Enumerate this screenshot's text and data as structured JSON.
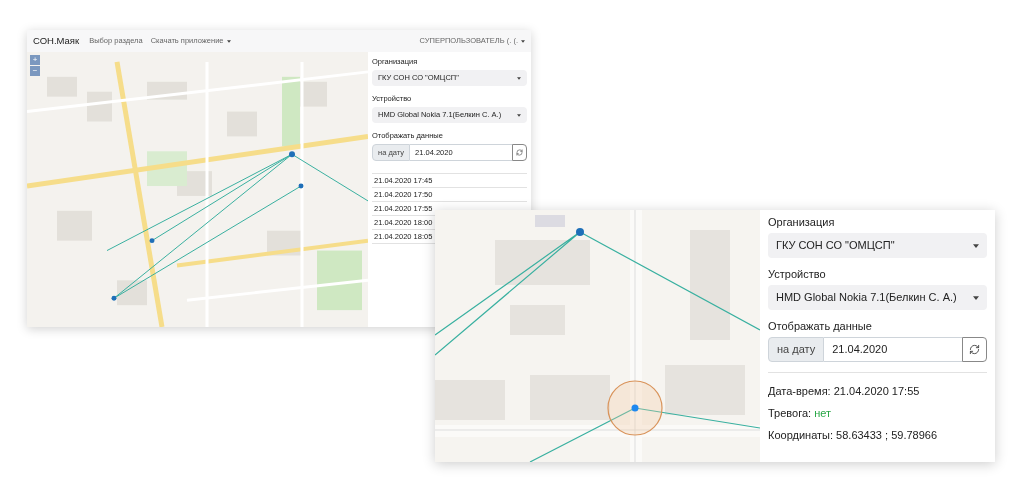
{
  "back_window": {
    "brand": "СОН.Маяк",
    "nav": [
      {
        "label": "Выбор раздела",
        "dropdown": false
      },
      {
        "label": "Скачать приложение",
        "dropdown": true
      }
    ],
    "user": {
      "label": "СУПЕРПОЛЬЗОВАТЕЛЬ (. (.",
      "dropdown": true
    },
    "map": {
      "zoom_in": "+",
      "zoom_out": "−"
    },
    "panel": {
      "organization": {
        "label": "Организация",
        "value": "ГКУ СОН СО \"ОМЦСП\""
      },
      "device": {
        "label": "Устройство",
        "value": "HMD Global Nokia 7.1(Белкин С. А.)"
      },
      "display": {
        "label": "Отображать данные",
        "addon": "на дату",
        "value": "21.04.2020"
      },
      "records": [
        "21.04.2020 17:45",
        "21.04.2020 17:50",
        "21.04.2020 17:55",
        "21.04.2020 18:00",
        "21.04.2020 18:05"
      ]
    }
  },
  "front_window": {
    "panel": {
      "organization": {
        "label": "Организация",
        "value": "ГКУ СОН СО \"ОМЦСП\""
      },
      "device": {
        "label": "Устройство",
        "value": "HMD Global Nokia 7.1(Белкин С. А.)"
      },
      "display": {
        "label": "Отображать данные",
        "addon": "на дату",
        "value": "21.04.2020"
      },
      "details": {
        "datetime_label": "Дата-время:",
        "datetime": "21.04.2020 17:55",
        "alarm_label": "Тревога:",
        "alarm": "нет",
        "alarm_on": false,
        "coordinates_label": "Координаты:",
        "coordinates": "58.63433 ; 59.78966"
      }
    }
  }
}
